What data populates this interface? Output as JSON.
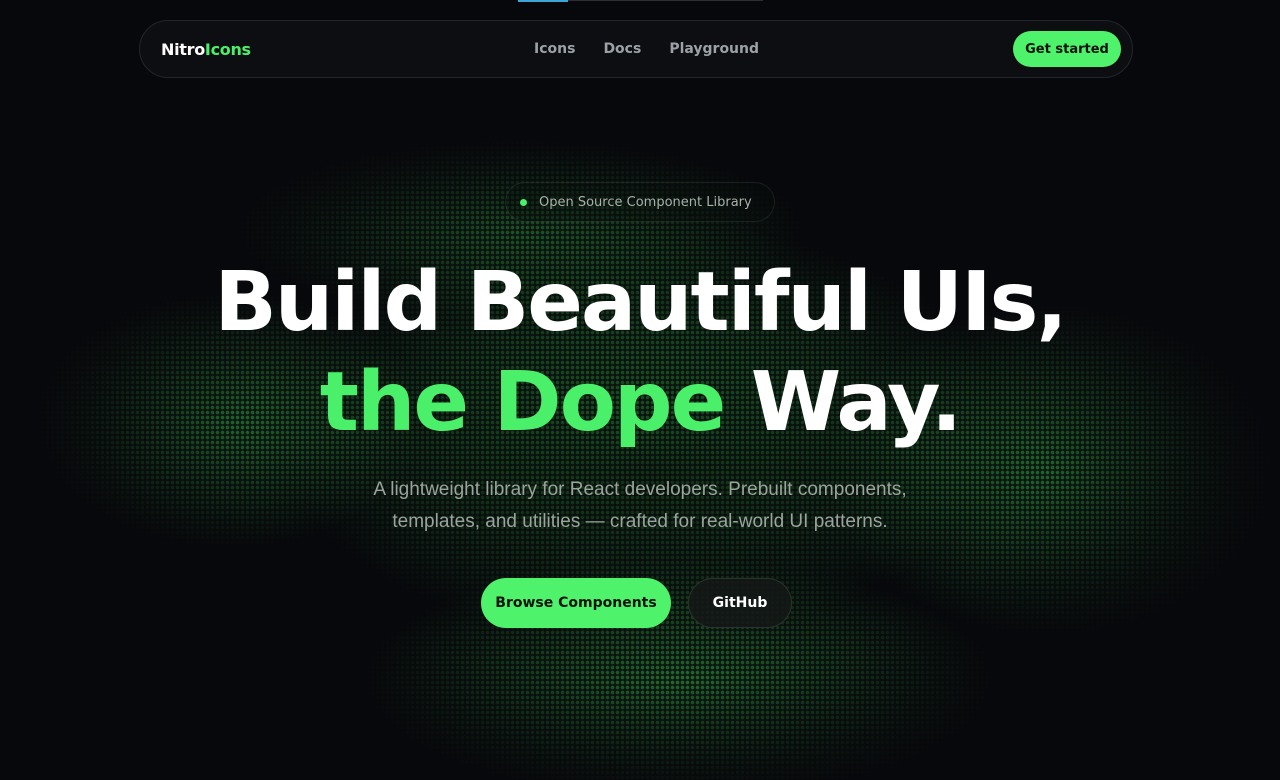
{
  "nav": {
    "brand_part1": "Nitro",
    "brand_part2": "Icons",
    "links": [
      {
        "label": "Icons"
      },
      {
        "label": "Docs"
      },
      {
        "label": "Playground"
      }
    ],
    "cta_label": "Get started"
  },
  "hero": {
    "badge_text": "Open Source Component Library",
    "title_line1": "Build Beautiful UIs,",
    "title_line2_green": "the Dope",
    "title_line2_white": "Way.",
    "subtitle_line1": "A lightweight library for React developers. Prebuilt components,",
    "subtitle_line2": "templates, and utilities — crafted for real-world UI patterns.",
    "primary_button": "Browse Components",
    "secondary_button": "GitHub"
  },
  "colors": {
    "accent": "#4af069",
    "background": "#07080b"
  }
}
